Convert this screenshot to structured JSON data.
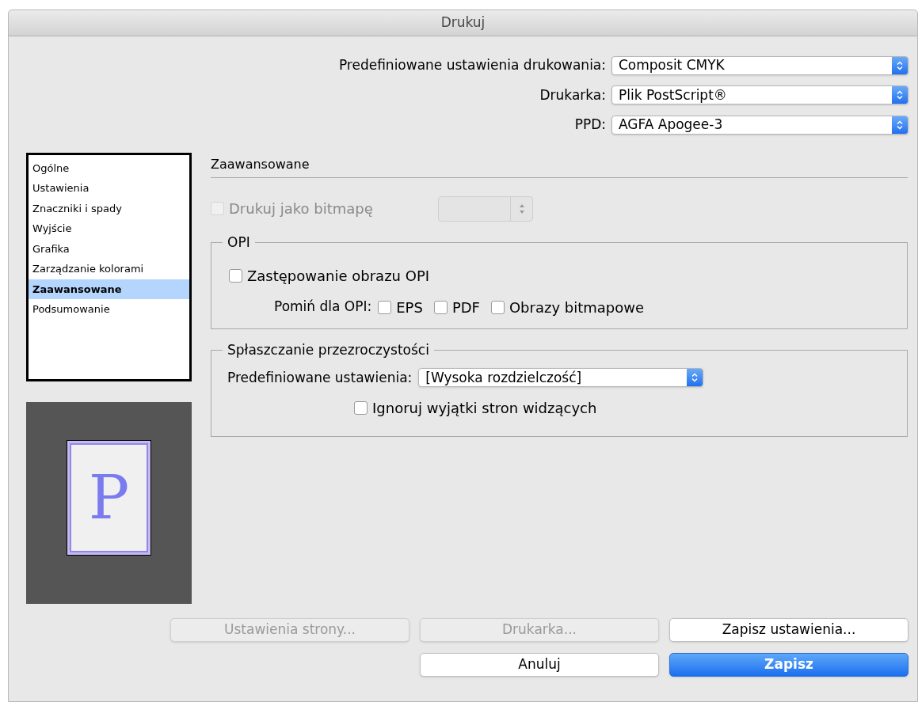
{
  "window": {
    "title": "Drukuj"
  },
  "top_fields": [
    {
      "label": "Predefiniowane ustawienia drukowania:",
      "value": "Composit CMYK"
    },
    {
      "label": "Drukarka:",
      "value": "Plik PostScript®"
    },
    {
      "label": "PPD:",
      "value": "AGFA Apogee-3"
    }
  ],
  "sidebar": {
    "items": [
      {
        "label": "Ogólne",
        "selected": false
      },
      {
        "label": "Ustawienia",
        "selected": false
      },
      {
        "label": "Znaczniki i spady",
        "selected": false
      },
      {
        "label": "Wyjście",
        "selected": false
      },
      {
        "label": "Grafika",
        "selected": false
      },
      {
        "label": "Zarządzanie kolorami",
        "selected": false
      },
      {
        "label": "Zaawansowane",
        "selected": true
      },
      {
        "label": "Podsumowanie",
        "selected": false
      }
    ]
  },
  "preview": {
    "letter": "P"
  },
  "section": {
    "title": "Zaawansowane",
    "bitmap": {
      "label": "Drukuj jako bitmapę",
      "checked": false,
      "disabled": true
    },
    "opi": {
      "title": "OPI",
      "replace": {
        "label": "Zastępowanie obrazu OPI",
        "checked": false
      },
      "omit_label": "Pomiń dla OPI:",
      "omit": [
        {
          "label": "EPS",
          "checked": false
        },
        {
          "label": "PDF",
          "checked": false
        },
        {
          "label": "Obrazy bitmapowe",
          "checked": false
        }
      ]
    },
    "flattening": {
      "title": "Spłaszczanie przezroczystości",
      "preset_label": "Predefiniowane ustawienia:",
      "preset_value": "[Wysoka rozdzielczość]",
      "ignore": {
        "label": "Ignoruj wyjątki stron widzących",
        "checked": false
      }
    }
  },
  "buttons_row1": [
    {
      "label": "Ustawienia strony...",
      "disabled": true,
      "primary": false
    },
    {
      "label": "Drukarka...",
      "disabled": true,
      "primary": false
    },
    {
      "label": "Zapisz ustawienia...",
      "disabled": false,
      "primary": false
    }
  ],
  "buttons_row2": [
    {
      "label": "Anuluj",
      "disabled": false,
      "primary": false
    },
    {
      "label": "Zapisz",
      "disabled": false,
      "primary": true
    }
  ]
}
